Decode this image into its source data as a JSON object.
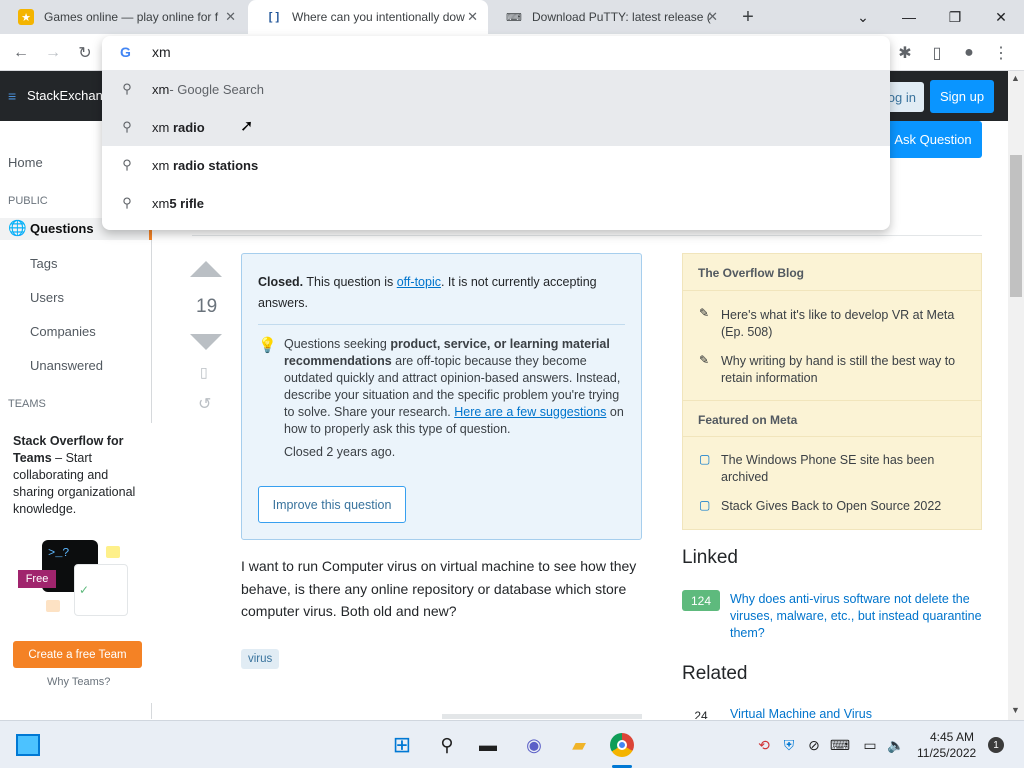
{
  "tabs": [
    {
      "title": "Games online — play online for f",
      "favicon": "games-icon"
    },
    {
      "title": "Where can you intentionally dow",
      "favicon": "stackexchange-icon"
    },
    {
      "title": "Download PuTTY: latest release (",
      "favicon": "putty-icon"
    }
  ],
  "omnibox": {
    "input": "xm",
    "suggestions": [
      {
        "prefix": "xm",
        "bold": "",
        "suffix": " - Google Search"
      },
      {
        "prefix": "xm ",
        "bold": "radio",
        "suffix": ""
      },
      {
        "prefix": "xm ",
        "bold": "radio stations",
        "suffix": ""
      },
      {
        "prefix": "xm",
        "bold": "5 rifle",
        "suffix": ""
      }
    ]
  },
  "se": {
    "logo": "StackExchange",
    "login": "Log in",
    "signup": "Sign up",
    "ask": "Ask Question"
  },
  "nav": {
    "home": "Home",
    "public": "PUBLIC",
    "questions": "Questions",
    "tags": "Tags",
    "users": "Users",
    "companies": "Companies",
    "unanswered": "Unanswered",
    "teams": "TEAMS"
  },
  "teams": {
    "title": "Stack Overflow for Teams",
    "desc": " – Start collaborating and sharing organizational knowledge.",
    "free": "Free",
    "create": "Create a free Team",
    "why": "Why Teams?"
  },
  "vote": {
    "count": "19"
  },
  "notice": {
    "closed": "Closed.",
    "text1": " This question is ",
    "offtopic": "off-topic",
    "text2": ". It is not currently accepting answers.",
    "reason_a": "Questions seeking ",
    "reason_b": "product, service, or learning material recommendations",
    "reason_c": " are off-topic because they become outdated quickly and attract opinion-based answers. Instead, describe your situation and the specific problem you're trying to solve. Share your research. ",
    "reason_link": "Here are a few suggestions",
    "reason_d": " on how to properly ask this type of question.",
    "closed_when": "Closed 2 years ago.",
    "improve": "Improve this question"
  },
  "question": {
    "body": "I want to run Computer virus on virtual machine to see how they behave, is there any online repository or database which store computer virus. Both old and new?",
    "tag": "virus"
  },
  "blog": {
    "title": "The Overflow Blog",
    "items": [
      "Here's what it's like to develop VR at Meta (Ep. 508)",
      "Why writing by hand is still the best way to retain information"
    ],
    "meta_title": "Featured on Meta",
    "meta_items": [
      "The Windows Phone SE site has been archived",
      "Stack Gives Back to Open Source 2022"
    ]
  },
  "linked": {
    "title": "Linked",
    "items": [
      {
        "score": "124",
        "text": "Why does anti-virus software not delete the viruses, malware, etc., but instead quarantine them?"
      }
    ]
  },
  "related": {
    "title": "Related",
    "items": [
      {
        "score": "24",
        "text": "Virtual Machine and Virus"
      }
    ]
  },
  "clock": {
    "time": "4:45 AM",
    "date": "11/25/2022"
  },
  "notifications": "1",
  "colors": {
    "accent": "#0a95ff",
    "orange": "#f48225",
    "green": "#5eba7d"
  }
}
